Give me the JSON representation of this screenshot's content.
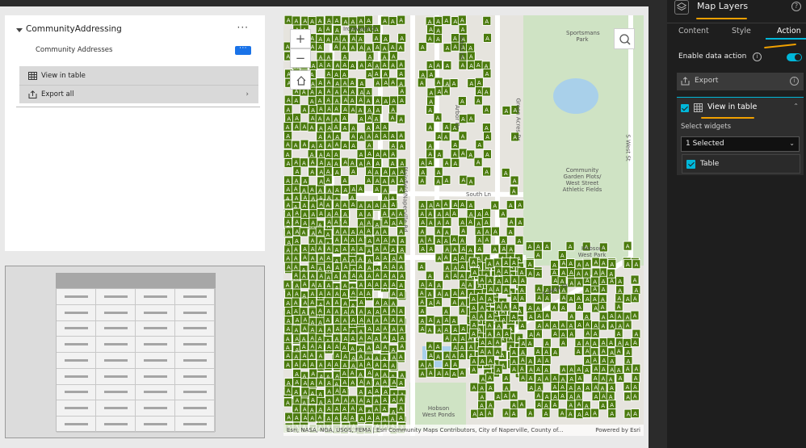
{
  "layers_widget": {
    "title": "CommunityAddressing",
    "more_label": "···",
    "layer_name": "Community Addresses",
    "action_button_label": "···",
    "menu": [
      {
        "label": "View in table",
        "icon": "table-icon"
      },
      {
        "label": "Export all",
        "icon": "export-icon",
        "chevron": "›"
      }
    ]
  },
  "table_widget": {
    "icon": "table-placeholder-icon"
  },
  "map": {
    "zoom_in": "+",
    "zoom_out": "−",
    "home_icon": "home-icon",
    "search_icon": "search-icon",
    "marker_label": "A",
    "marker_color": "#4a7a0c",
    "street_labels": [
      "Ironwood Ct",
      "Arbor Dr",
      "Arbor Dr",
      "Green Acres Dr",
      "Sportsmans Park",
      "South Ln",
      "Plainfield/Naperville Rd",
      "Community Garden Plots/ West Street Athletic Fields",
      "S West St",
      "S West St",
      "Hobson West Ponds",
      "Hobson West Park"
    ],
    "attribution": "Esri, NASA, NGA, USGS, FEMA | Esri Community Maps Contributors, City of Naperville, County of...",
    "powered_by": "Powered by Esri"
  },
  "settings_panel": {
    "title": "Map Layers",
    "help_icon": "?",
    "tabs": [
      {
        "label": "Content"
      },
      {
        "label": "Style"
      },
      {
        "label": "Action",
        "active": true
      }
    ],
    "enable_data_action": {
      "label": "Enable data action",
      "enabled": true
    },
    "actions": {
      "export": {
        "label": "Export"
      },
      "view_in_table": {
        "label": "View in table",
        "checked": true,
        "select_widgets_label": "Select widgets",
        "select_value": "1 Selected",
        "options": [
          {
            "label": "Table",
            "checked": true
          }
        ]
      }
    },
    "accent_color": "#00b7d9",
    "annotation_color": "#f0a000"
  }
}
